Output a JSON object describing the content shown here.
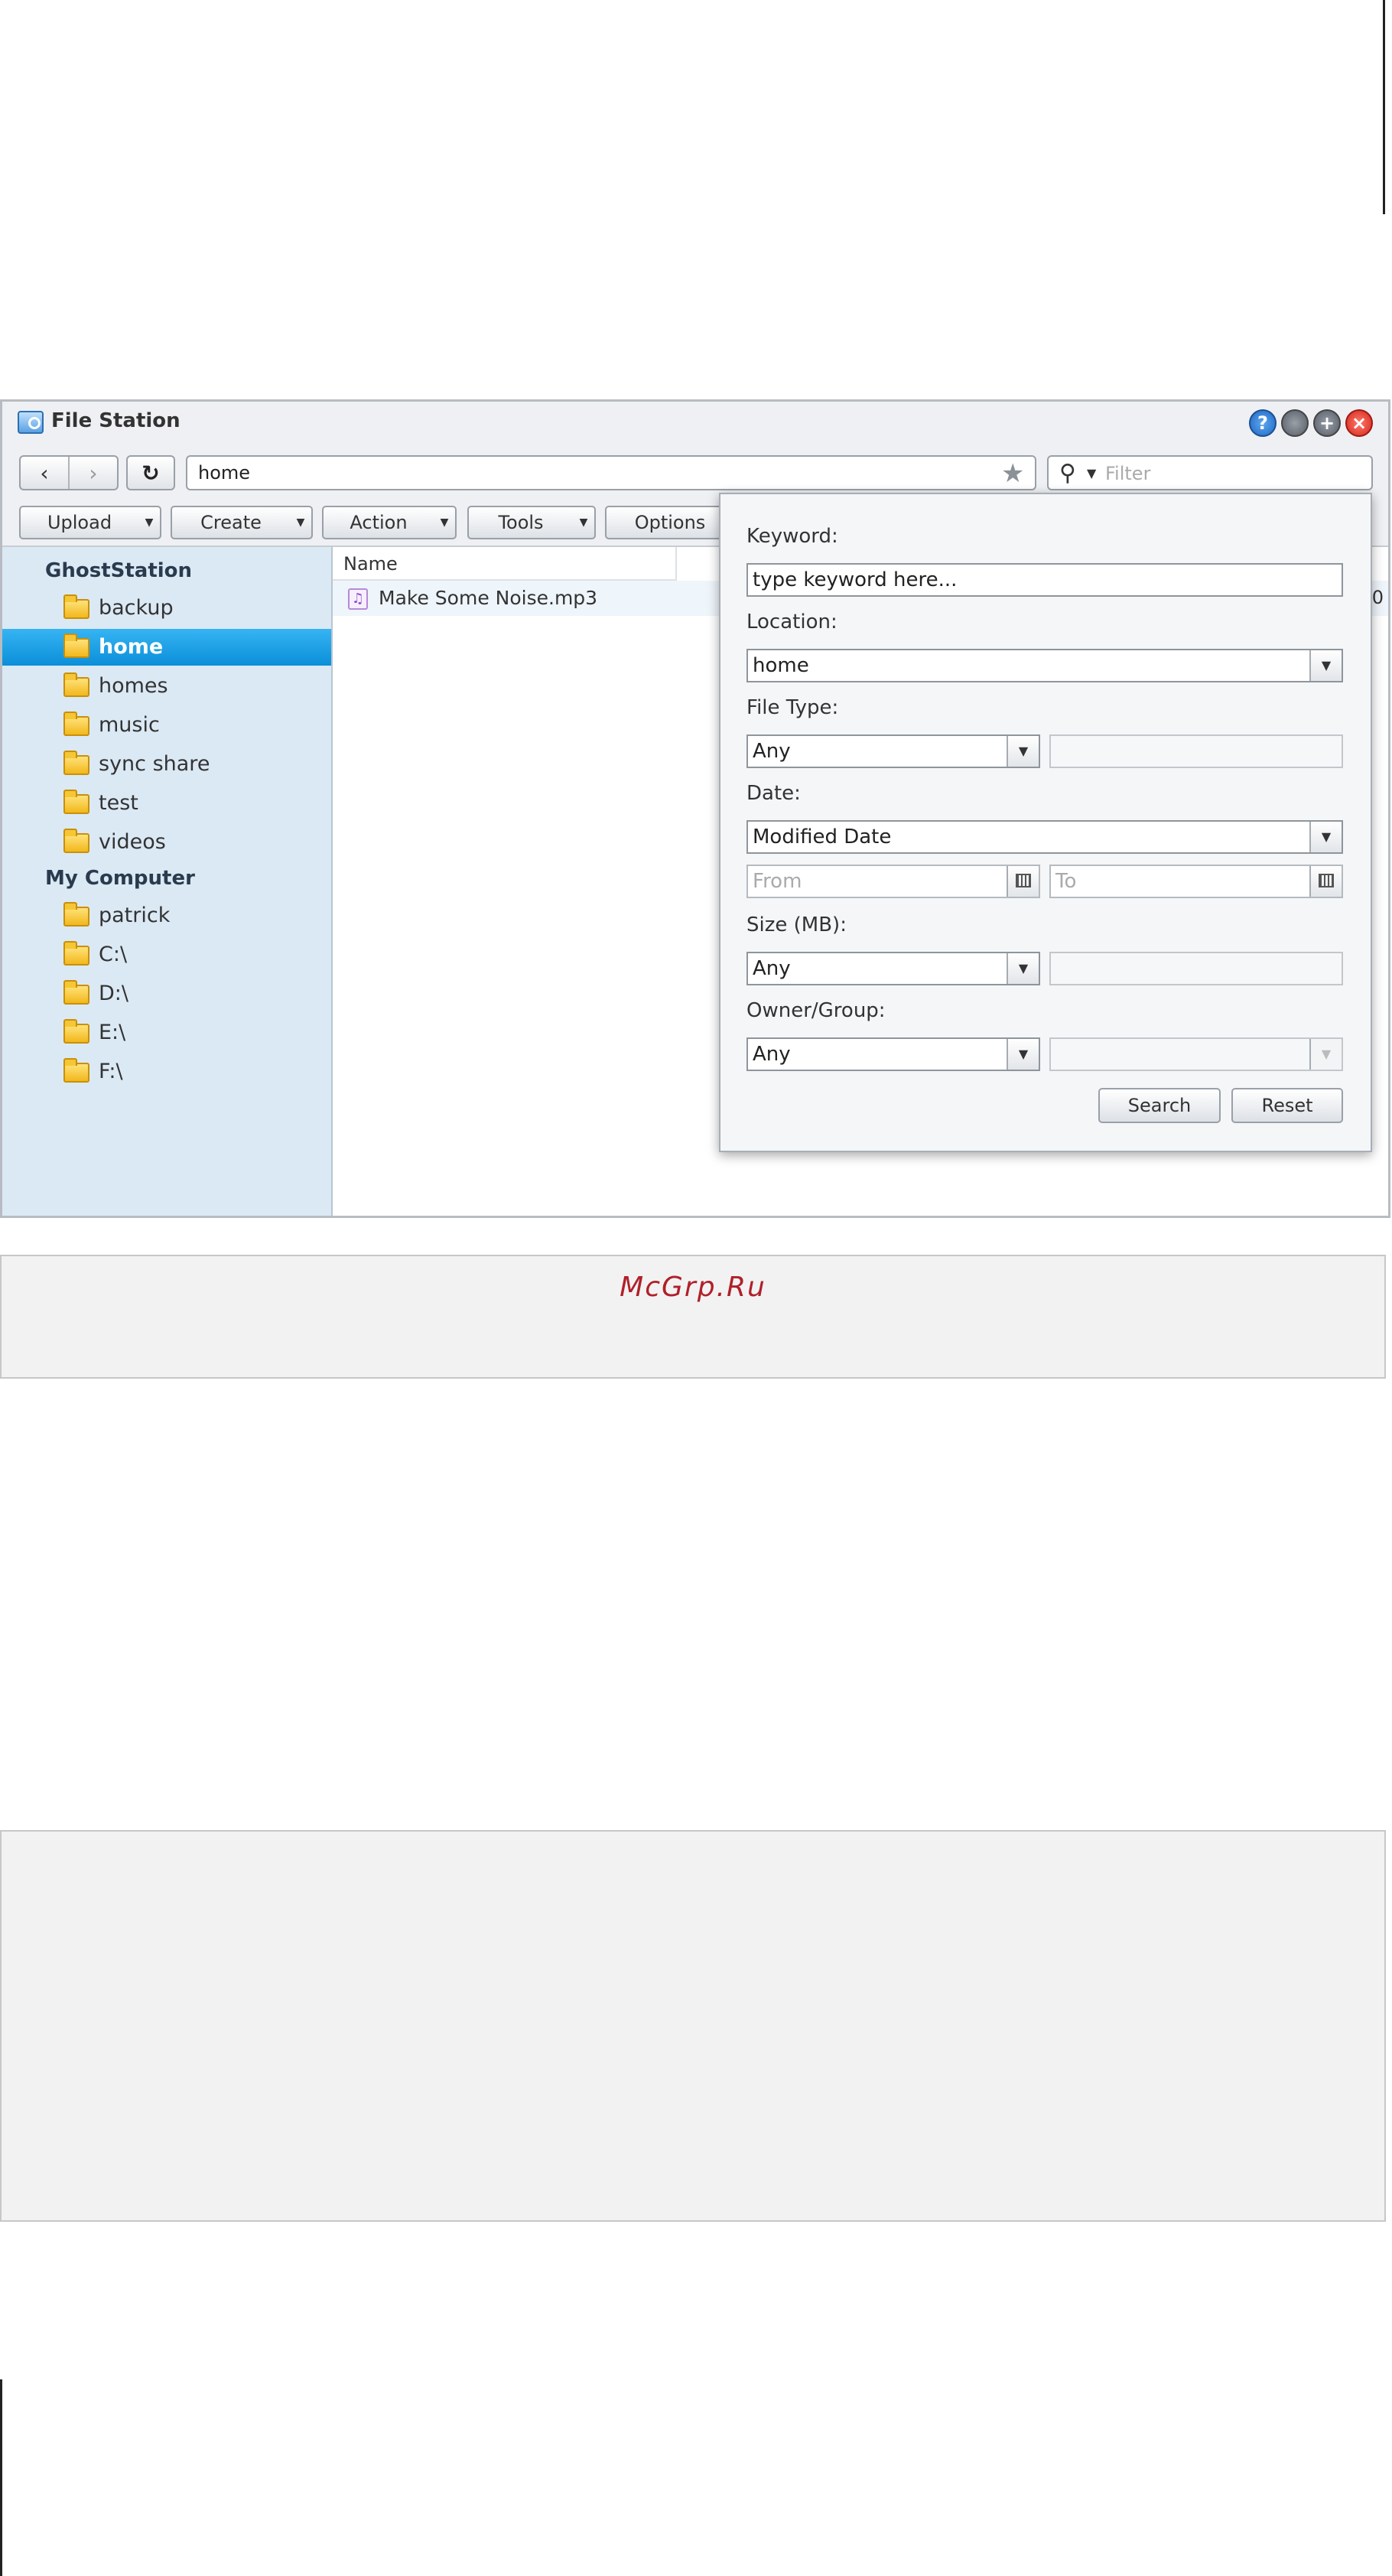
{
  "window": {
    "title": "File Station",
    "controls": {
      "help": "?",
      "minimize": "",
      "maximize": "+",
      "close": "×"
    }
  },
  "address": {
    "back": "‹",
    "forward": "›",
    "refresh": "↻",
    "path": "home",
    "filter_placeholder": "Filter"
  },
  "toolbar": {
    "upload": "Upload",
    "create": "Create",
    "action": "Action",
    "tools": "Tools",
    "options": "Options"
  },
  "sidebar": {
    "ghoststation": {
      "label": "GhostStation",
      "items": [
        "backup",
        "home",
        "homes",
        "music",
        "sync share",
        "test",
        "videos"
      ]
    },
    "my_computer": {
      "label": "My Computer",
      "items": [
        "patrick",
        "C:\\",
        "D:\\",
        "E:\\",
        "F:\\"
      ]
    },
    "selected": "home"
  },
  "filelist": {
    "column_name": "Name",
    "files": [
      {
        "name": "Make Some Noise.mp3",
        "trailing": "0"
      }
    ]
  },
  "search": {
    "keyword_label": "Keyword:",
    "keyword_placeholder": "type keyword here...",
    "location_label": "Location:",
    "location_value": "home",
    "filetype_label": "File Type:",
    "filetype_value": "Any",
    "date_label": "Date:",
    "date_value": "Modified Date",
    "from_placeholder": "From",
    "to_placeholder": "To",
    "size_label": "Size (MB):",
    "size_value": "Any",
    "owner_label": "Owner/Group:",
    "owner_value": "Any",
    "search_button": "Search",
    "reset_button": "Reset"
  },
  "footer": {
    "brand": "McGrp.Ru"
  },
  "colors": {
    "selection": "#0b8fd9",
    "sidebar": "#dbe9f5",
    "brand": "#b0202a"
  }
}
